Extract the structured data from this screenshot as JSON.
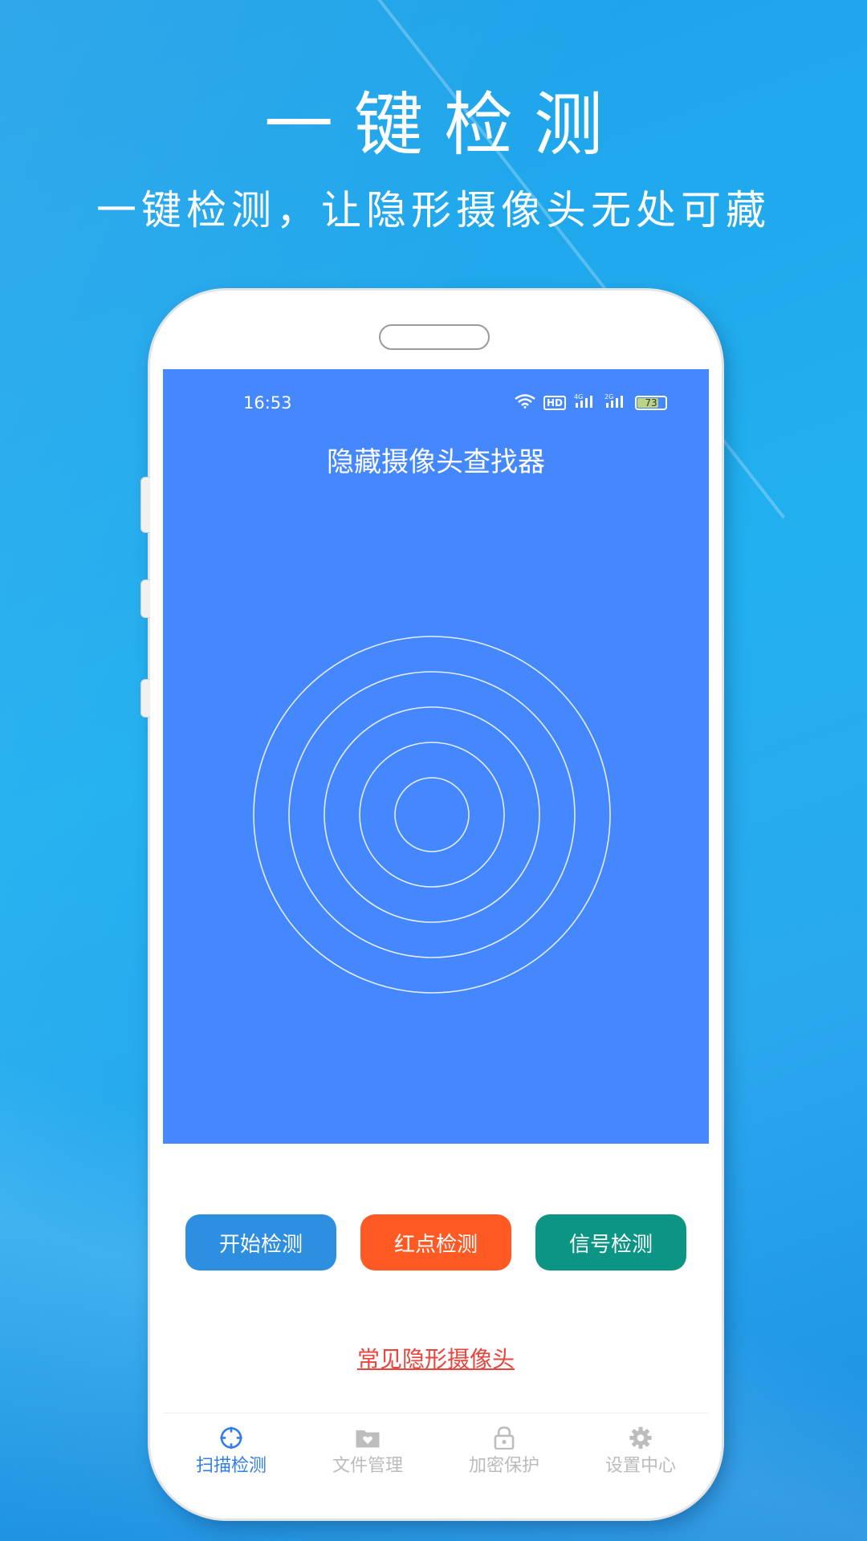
{
  "promo": {
    "title": "一键检测",
    "subtitle": "一键检测，让隐形摄像头无处可藏"
  },
  "status_bar": {
    "time": "16:53",
    "network_1": "4G",
    "network_2": "2G",
    "hd_label": "HD",
    "battery": "73"
  },
  "app": {
    "title": "隐藏摄像头查找器"
  },
  "actions": {
    "start": "开始检测",
    "red_dot": "红点检测",
    "signal": "信号检测"
  },
  "link": {
    "common_cameras": "常见隐形摄像头"
  },
  "tabs": [
    {
      "label": "扫描检测",
      "icon": "crosshair-icon",
      "active": true
    },
    {
      "label": "文件管理",
      "icon": "folder-heart-icon",
      "active": false
    },
    {
      "label": "加密保护",
      "icon": "lock-icon",
      "active": false
    },
    {
      "label": "设置中心",
      "icon": "gear-icon",
      "active": false
    }
  ],
  "colors": {
    "background": "#22b0f0",
    "screen_primary": "#4487fe",
    "start_button": "#2e8ee0",
    "red_dot_button": "#ff5a24",
    "signal_button": "#0c9485",
    "link": "#e8453c",
    "tab_active": "#2f7dea",
    "tab_inactive": "#bbbbbb"
  }
}
